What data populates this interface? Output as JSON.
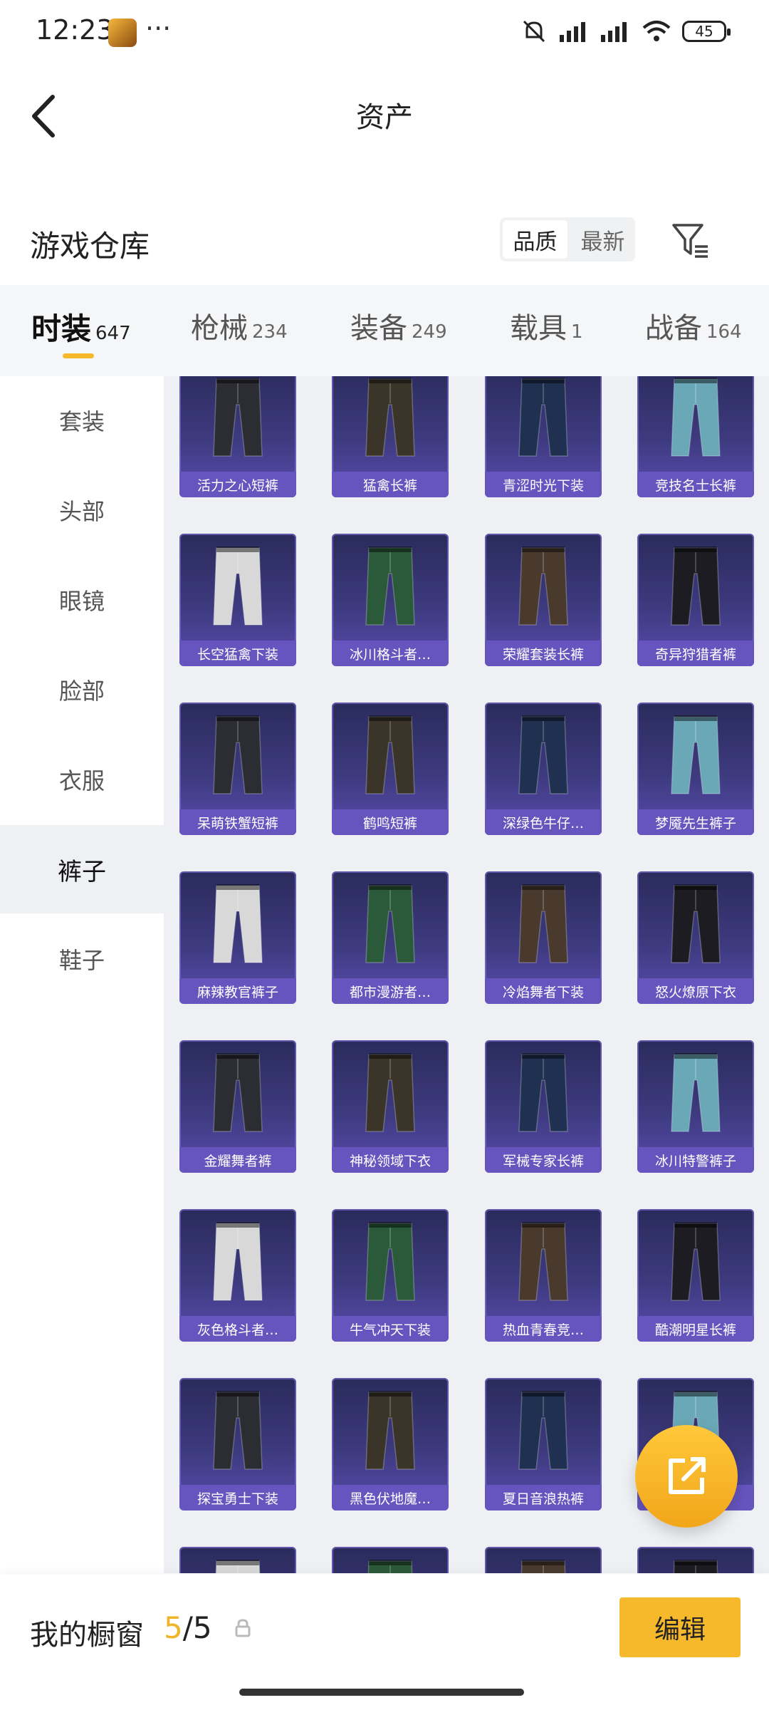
{
  "status_bar": {
    "time": "12:23",
    "battery": "45",
    "more": "···"
  },
  "header": {
    "title": "资产"
  },
  "warehouse": {
    "title": "游戏仓库",
    "sort_options": [
      "品质",
      "最新"
    ],
    "sort_selected": "品质"
  },
  "tabs": [
    {
      "label": "时装",
      "count": "647"
    },
    {
      "label": "枪械",
      "count": "234"
    },
    {
      "label": "装备",
      "count": "249"
    },
    {
      "label": "载具",
      "count": "1"
    },
    {
      "label": "战备",
      "count": "164"
    }
  ],
  "sidebar": [
    "套装",
    "头部",
    "眼镜",
    "脸部",
    "衣服",
    "裤子",
    "鞋子"
  ],
  "sidebar_active": "裤子",
  "items": [
    "活力之心短裤",
    "猛禽长裤",
    "青涩时光下装",
    "竞技名士长裤",
    "长空猛禽下装",
    "冰川格斗者…",
    "荣耀套装长裤",
    "奇异狩猎者裤",
    "呆萌铁蟹短裤",
    "鹤鸣短裤",
    "深绿色牛仔…",
    "梦魇先生裤子",
    "麻辣教官裤子",
    "都市漫游者…",
    "冷焰舞者下装",
    "怒火燎原下衣",
    "金耀舞者裤",
    "神秘领域下衣",
    "军械专家长裤",
    "冰川特警裤子",
    "灰色格斗者…",
    "牛气冲天下装",
    "热血青春竞…",
    "酷潮明星长裤",
    "探宝勇士下装",
    "黑色伏地魔…",
    "夏日音浪热裤",
    "…"
  ],
  "showcase": {
    "label": "我的橱窗",
    "current": "5",
    "total": "/5",
    "edit_label": "编辑"
  },
  "colors": {
    "accent": "#f5b92b",
    "card_bg": "#3d3a7e",
    "card_label": "#6655bf"
  }
}
